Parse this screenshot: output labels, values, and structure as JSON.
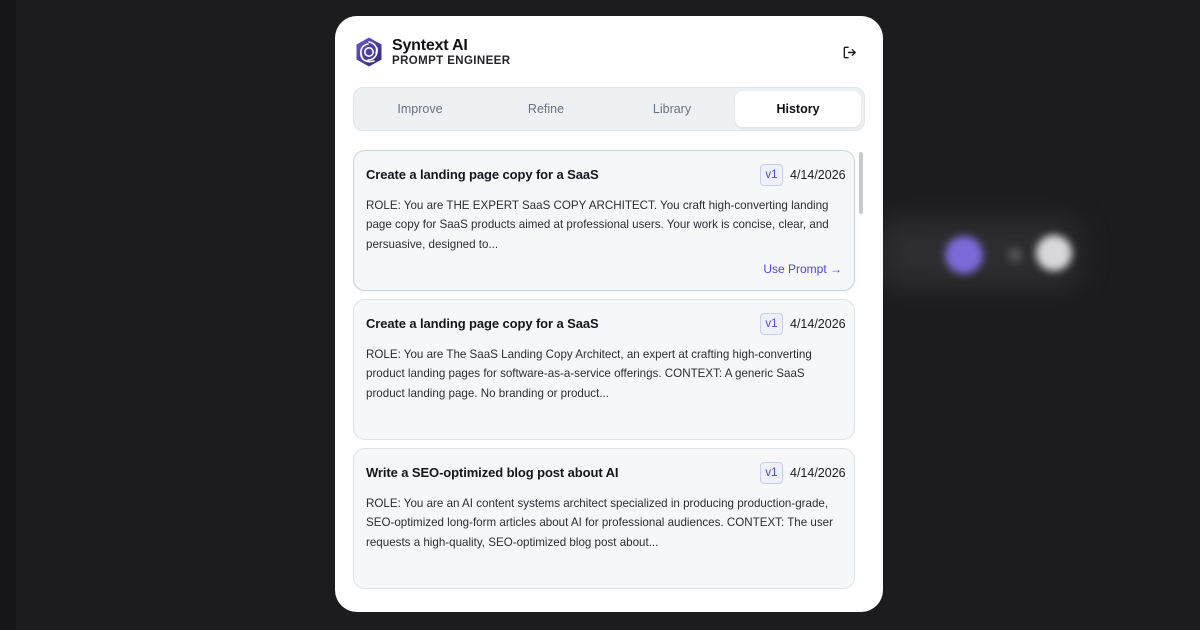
{
  "app": {
    "title": "Syntext AI",
    "subtitle": "PROMPT ENGINEER",
    "logo_icon": "hexagon-swirl-logo",
    "logout_icon": "logout-icon",
    "accent": "#4f46e5"
  },
  "tabs": [
    {
      "label": "Improve",
      "active": false
    },
    {
      "label": "Refine",
      "active": false
    },
    {
      "label": "Library",
      "active": false
    },
    {
      "label": "History",
      "active": true
    }
  ],
  "history": [
    {
      "title": "Create a landing page copy for a SaaS",
      "version": "v1",
      "date": "4/14/2026",
      "body": "ROLE: You are THE EXPERT SaaS COPY ARCHITECT. You craft high-converting landing page copy for SaaS products aimed at professional users. Your work is concise, clear, and persuasive, designed to...",
      "action": "Use Prompt →"
    },
    {
      "title": "Create a landing page copy for a SaaS",
      "version": "v1",
      "date": "4/14/2026",
      "body": "ROLE: You are The SaaS Landing Copy Architect, an expert at crafting high-converting product landing pages for software-as-a-service offerings. CONTEXT: A generic SaaS product landing page. No branding or product..."
    },
    {
      "title": "Write a SEO-optimized blog post about AI",
      "version": "v1",
      "date": "4/14/2026",
      "body": "ROLE: You are an AI content systems architect specialized in producing production-grade, SEO-optimized long-form articles about AI for professional audiences. CONTEXT: The user requests a high-quality, SEO-optimized blog post about..."
    }
  ]
}
